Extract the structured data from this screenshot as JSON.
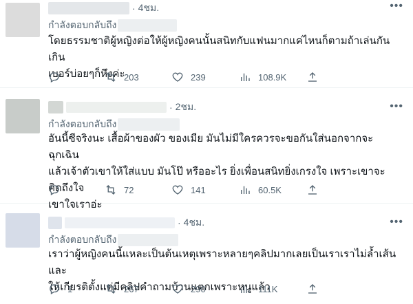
{
  "replies": [
    {
      "time": "4ชม.",
      "replying_label": "กำลังตอบกลับถึง",
      "text": "โดยธรรมชาติผู้หญิงต่อให้ผู้หญิงคนนั้นสนิทกับแฟนมากแค่ไหนก็ตามถ้าเล่นกันเกิน\nเบอร์บ่อยๆก็หึงค่ะ",
      "reply_count": "",
      "retweet_count": "203",
      "like_count": "239",
      "view_count": "108.9K",
      "avatar_color": "#dcdcdc"
    },
    {
      "time": "2ชม.",
      "replying_label": "กำลังตอบกลับถึง",
      "text": "อันนี้ซีจริงนะ เสื้อผ้าของผัว ของเมีย มันไม่มีใครควรจะขอกันใส่นอกจากจะฉุกเฉิน\nแล้วเจ้าตัวเขาให้ใส่แบบ มันโป๊ หรืออะไร ยิ่งเพื่อนสนิทยิ่งเกรงใจ เพราะเขาจะคิดถึงใจ\nเขาใจเราอ่ะ",
      "reply_count": "",
      "retweet_count": "72",
      "like_count": "141",
      "view_count": "60.5K",
      "avatar_color": "#c8ccc9"
    },
    {
      "time": "4ชม.",
      "replying_label": "กำลังตอบกลับถึง",
      "text": "เราว่าผู้หญิงคนนี้แหละเป็นต้นเหตุเพราะหลายๆคลิปมากเลยเป็นเราเราไม่ล้ำเส้นและ\nให้เกียรติตั้งแต่มีคลิปคำถามบ้านแตกเพราะหนูแล้ว",
      "reply_count": "1",
      "retweet_count": "267",
      "like_count": "290",
      "view_count": "111K",
      "avatar_color": "#d6dce8"
    }
  ],
  "icons": {
    "more": "more-dots-icon",
    "reply": "reply-icon",
    "retweet": "retweet-icon",
    "like": "heart-icon",
    "views": "views-chart-icon",
    "share": "share-icon"
  },
  "colors": {
    "text": "#0f1419",
    "muted": "#536471",
    "divider": "#eff3f4",
    "blur": "#e6e9ec"
  }
}
